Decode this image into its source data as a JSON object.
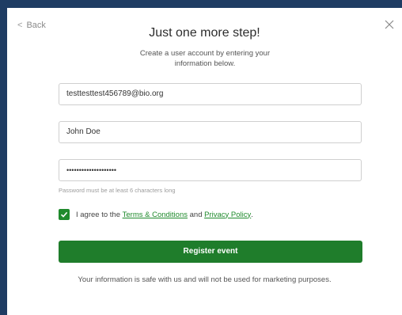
{
  "header": {
    "back_label": "Back",
    "title": "Just one more step!",
    "subtitle": "Create a user account by entering your information below."
  },
  "form": {
    "email_value": "testtesttest456789@bio.org",
    "name_value": "John Doe",
    "password_value": "••••••••••••••••••••",
    "password_hint": "Password must be at least 6 characters long"
  },
  "agreement": {
    "checked": true,
    "prefix": "I agree to the",
    "terms_link": "Terms & Conditions",
    "and": "and",
    "privacy_link": "Privacy Policy",
    "suffix": "."
  },
  "actions": {
    "register_label": "Register event"
  },
  "footer": {
    "safe_note": "Your information is safe with us and will not be used for marketing purposes."
  },
  "colors": {
    "accent": "#1f7d2b",
    "link": "#1f8a2c",
    "background": "#1f3c63"
  },
  "icons": {
    "back": "chevron-left-icon",
    "close": "close-icon",
    "checkbox": "checkmark-icon"
  }
}
